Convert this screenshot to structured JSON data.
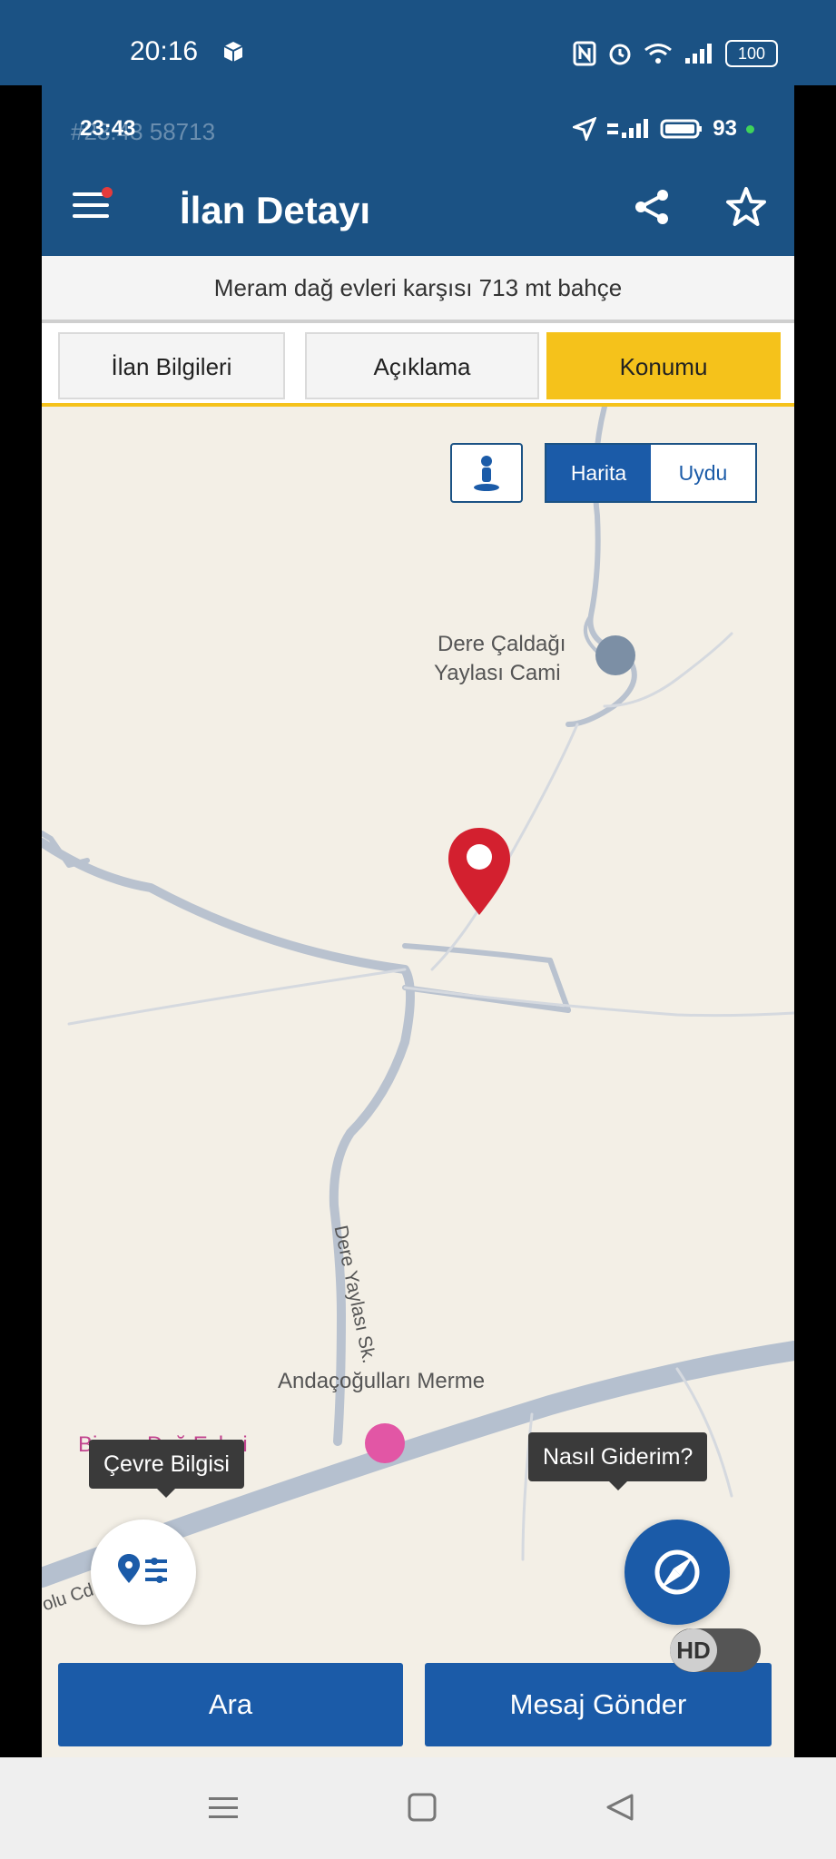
{
  "system_status": {
    "time": "20:16",
    "battery": "100"
  },
  "inner_status": {
    "time": "23:43",
    "ghost_text": "#23:43 58713",
    "battery_pct": "93"
  },
  "header": {
    "title": "İlan Detayı"
  },
  "listing": {
    "subtitle": "Meram dağ evleri karşısı 713 mt bahçe"
  },
  "tabs": [
    {
      "label": "İlan Bilgileri",
      "active": false
    },
    {
      "label": "Açıklama",
      "active": false
    },
    {
      "label": "Konumu",
      "active": true
    }
  ],
  "map": {
    "type_toggle": {
      "map_label": "Harita",
      "satellite_label": "Uydu",
      "selected": "Harita"
    },
    "labels": {
      "mosque_line1": "Dere Çaldağı",
      "mosque_line2": "Yaylası Cami",
      "road1": "Dere Yaylası Sk.",
      "poi2": "Andaçoğulları Merme",
      "hotel": "Bi      ram Dağ Evleri",
      "road2": "olu Cd."
    },
    "tooltips": {
      "environment": "Çevre Bilgisi",
      "directions": "Nasıl Giderim?"
    }
  },
  "actions": {
    "call_label": "Ara",
    "message_label": "Mesaj Gönder"
  },
  "hd_toggle": "HD",
  "colors": {
    "primary": "#1b5284",
    "button_blue": "#1b5ba8",
    "tab_active": "#f5c21b",
    "pin_red": "#d3202f",
    "map_bg": "#f3efe6",
    "road": "#b9c2cf"
  },
  "icons": {
    "menu": "hamburger-icon",
    "share": "share-icon",
    "favorite": "star-icon",
    "streetview": "person-icon",
    "env": "location-list-icon",
    "directions": "compass-icon"
  }
}
